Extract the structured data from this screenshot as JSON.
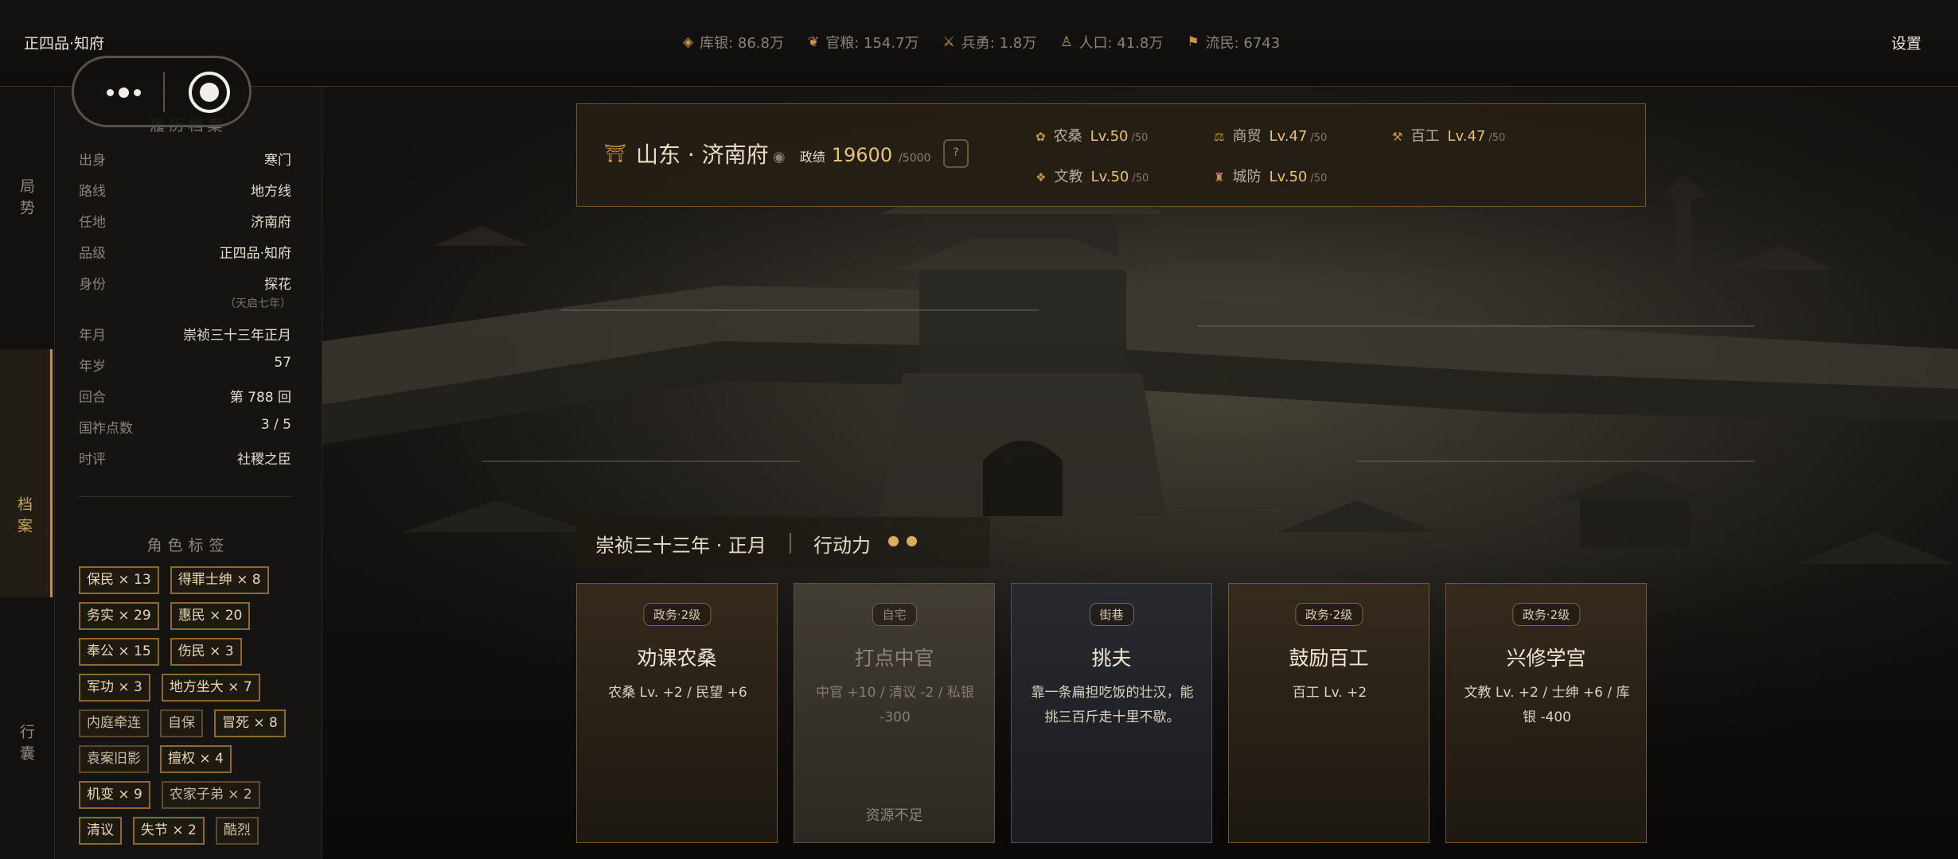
{
  "topbar": {
    "rank_title": "正四品·知府",
    "settings": "设置",
    "resources": [
      {
        "icon": "silver-icon",
        "text": "库银: 86.8万"
      },
      {
        "icon": "grain-icon",
        "text": "官粮: 154.7万"
      },
      {
        "icon": "soldier-icon",
        "text": "兵勇: 1.8万"
      },
      {
        "icon": "population-icon",
        "text": "人口: 41.8万"
      },
      {
        "icon": "refugee-icon",
        "text": "流民: 6743"
      }
    ]
  },
  "nav": {
    "items": [
      {
        "label": "局势",
        "active": false
      },
      {
        "label": "档案",
        "active": true
      },
      {
        "label": "行囊",
        "active": false
      }
    ]
  },
  "profile": {
    "title": "履历档案",
    "rows": [
      {
        "label": "出身",
        "value": "寒门"
      },
      {
        "label": "路线",
        "value": "地方线"
      },
      {
        "label": "任地",
        "value": "济南府"
      },
      {
        "label": "品级",
        "value": "正四品·知府"
      },
      {
        "label": "身份",
        "value": "探花"
      },
      {
        "label": "年月",
        "value": "崇祯三十三年正月"
      },
      {
        "label": "年岁",
        "value": "57"
      },
      {
        "label": "回合",
        "value": "第 788 回"
      },
      {
        "label": "国祚点数",
        "value": "3 / 5"
      },
      {
        "label": "时评",
        "value": "社稷之臣"
      }
    ],
    "identity_sub": "（天启七年）",
    "tags_title": "角色标签",
    "tags": [
      [
        "保民 × 13",
        "得罪士绅 × 8"
      ],
      [
        "务实 × 29",
        "惠民 × 20"
      ],
      [
        "奉公 × 15",
        "伤民 × 3"
      ],
      [
        "军功 × 3",
        "地方坐大 × 7"
      ],
      [
        "内庭牵连",
        "自保",
        "冒死 × 8"
      ],
      [
        "袁案旧影",
        "擅权 × 4"
      ],
      [
        "机变 × 9",
        "农家子弟 × 2"
      ],
      [
        "清议",
        "失节 × 2",
        "酷烈"
      ]
    ]
  },
  "city": {
    "name": "山东 · 济南府",
    "perf_label": "政绩",
    "perf_value": "19600",
    "perf_max": "/5000",
    "help": "?",
    "stats": [
      {
        "icon": "farming-icon",
        "label": "农桑",
        "level": "Lv.50",
        "max": "/50"
      },
      {
        "icon": "trade-icon",
        "label": "商贸",
        "level": "Lv.47",
        "max": "/50"
      },
      {
        "icon": "craft-icon",
        "label": "百工",
        "level": "Lv.47",
        "max": "/50"
      },
      {
        "icon": "education-icon",
        "label": "文教",
        "level": "Lv.50",
        "max": "/50"
      },
      {
        "icon": "defense-icon",
        "label": "城防",
        "level": "Lv.50",
        "max": "/50"
      }
    ]
  },
  "turn": {
    "date": "崇祯三十三年 · 正月",
    "ap_label": "行动力",
    "ap_points": 2
  },
  "cards": [
    {
      "badge": "政务·2级",
      "title": "劝课农桑",
      "effect": "农桑 Lv. +2 / 民望 +6",
      "footer": ""
    },
    {
      "badge": "自宅",
      "title": "打点中官",
      "effect": "中官 +10 / 清议 -2 / 私银 -300",
      "footer": "资源不足"
    },
    {
      "badge": "街巷",
      "title": "挑夫",
      "effect": "靠一条扁担吃饭的壮汉，能挑三百斤走十里不歇。",
      "footer": ""
    },
    {
      "badge": "政务·2级",
      "title": "鼓励百工",
      "effect": "百工 Lv. +2",
      "footer": ""
    },
    {
      "badge": "政务·2级",
      "title": "兴修学宫",
      "effect": "文教 Lv. +2 / 士绅 +6 / 库银 -400",
      "footer": ""
    }
  ],
  "colors": {
    "accent": "#c8963f",
    "gold_text": "#e4c27d",
    "panel_bg": "#151412"
  }
}
